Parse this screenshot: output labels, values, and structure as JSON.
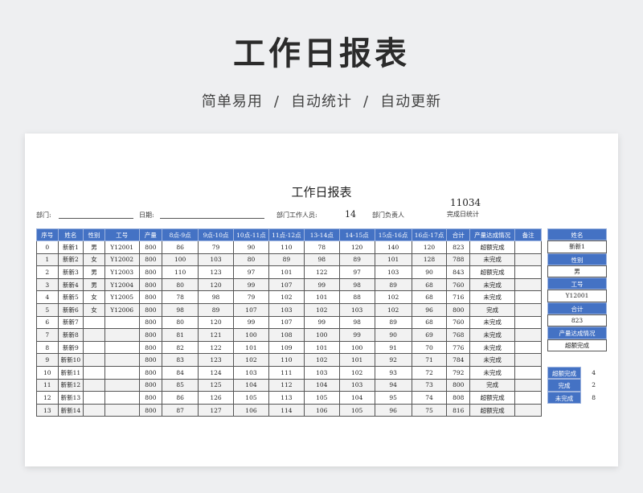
{
  "hero": {
    "title": "工作日报表",
    "subtitle_parts": [
      "简单易用",
      "自动统计",
      "自动更新"
    ],
    "separator": "/"
  },
  "doc": {
    "title": "工作日报表",
    "dept_label": "部门:",
    "date_label": "日期:",
    "staff_count_label": "部门工作人员:",
    "staff_count": "14",
    "leader_label": "部门负责人",
    "done_total": "11034",
    "done_total_label": "完成日统计"
  },
  "table": {
    "headers": [
      "序号",
      "姓名",
      "性别",
      "工号",
      "产量",
      "8点-9点",
      "9点-10点",
      "10点-11点",
      "11点-12点",
      "13-14点",
      "14-15点",
      "15点-16点",
      "16点-17点",
      "合计",
      "产量达成情况",
      "备注"
    ],
    "rows": [
      [
        "0",
        "新新1",
        "男",
        "Y12001",
        "800",
        "86",
        "79",
        "90",
        "110",
        "78",
        "120",
        "140",
        "120",
        "823",
        "超额完成",
        ""
      ],
      [
        "1",
        "新新2",
        "女",
        "Y12002",
        "800",
        "100",
        "103",
        "80",
        "89",
        "98",
        "89",
        "101",
        "128",
        "788",
        "未完成",
        ""
      ],
      [
        "2",
        "新新3",
        "男",
        "Y12003",
        "800",
        "110",
        "123",
        "97",
        "101",
        "122",
        "97",
        "103",
        "90",
        "843",
        "超额完成",
        ""
      ],
      [
        "3",
        "新新4",
        "男",
        "Y12004",
        "800",
        "80",
        "120",
        "99",
        "107",
        "99",
        "98",
        "89",
        "68",
        "760",
        "未完成",
        ""
      ],
      [
        "4",
        "新新5",
        "女",
        "Y12005",
        "800",
        "78",
        "98",
        "79",
        "102",
        "101",
        "88",
        "102",
        "68",
        "716",
        "未完成",
        ""
      ],
      [
        "5",
        "新新6",
        "女",
        "Y12006",
        "800",
        "98",
        "89",
        "107",
        "103",
        "102",
        "103",
        "102",
        "96",
        "800",
        "完成",
        ""
      ],
      [
        "6",
        "新新7",
        "",
        "",
        "800",
        "80",
        "120",
        "99",
        "107",
        "99",
        "98",
        "89",
        "68",
        "760",
        "未完成",
        ""
      ],
      [
        "7",
        "新新8",
        "",
        "",
        "800",
        "81",
        "121",
        "100",
        "108",
        "100",
        "99",
        "90",
        "69",
        "768",
        "未完成",
        ""
      ],
      [
        "8",
        "新新9",
        "",
        "",
        "800",
        "82",
        "122",
        "101",
        "109",
        "101",
        "100",
        "91",
        "70",
        "776",
        "未完成",
        ""
      ],
      [
        "9",
        "新新10",
        "",
        "",
        "800",
        "83",
        "123",
        "102",
        "110",
        "102",
        "101",
        "92",
        "71",
        "784",
        "未完成",
        ""
      ],
      [
        "10",
        "新新11",
        "",
        "",
        "800",
        "84",
        "124",
        "103",
        "111",
        "103",
        "102",
        "93",
        "72",
        "792",
        "未完成",
        ""
      ],
      [
        "11",
        "新新12",
        "",
        "",
        "800",
        "85",
        "125",
        "104",
        "112",
        "104",
        "103",
        "94",
        "73",
        "800",
        "完成",
        ""
      ],
      [
        "12",
        "新新13",
        "",
        "",
        "800",
        "86",
        "126",
        "105",
        "113",
        "105",
        "104",
        "95",
        "74",
        "808",
        "超额完成",
        ""
      ],
      [
        "13",
        "新新14",
        "",
        "",
        "800",
        "87",
        "127",
        "106",
        "114",
        "106",
        "105",
        "96",
        "75",
        "816",
        "超额完成",
        ""
      ]
    ]
  },
  "side": [
    {
      "label": "姓名",
      "value": "新新1"
    },
    {
      "label": "性别",
      "value": "男"
    },
    {
      "label": "工号",
      "value": "Y12001"
    },
    {
      "label": "合计",
      "value": "823"
    },
    {
      "label": "产量达成情况",
      "value": "超额完成"
    }
  ],
  "summary": [
    {
      "label": "超额完成",
      "value": "4"
    },
    {
      "label": "完成",
      "value": "2"
    },
    {
      "label": "未完成",
      "value": "8"
    }
  ],
  "colors": {
    "header_blue": "#4472c4"
  }
}
